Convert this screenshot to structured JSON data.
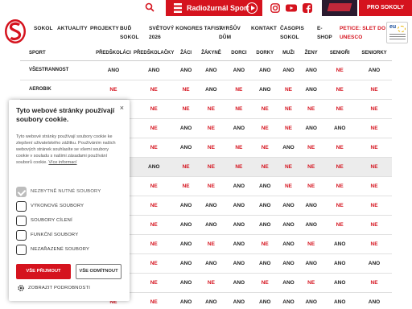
{
  "topbar": {
    "radio_label": "Radiožurnál Sport",
    "pro_sokoly": "PRO SOKOLY"
  },
  "nav": {
    "items": [
      {
        "l1": "SOKOL",
        "l2": ""
      },
      {
        "l1": "AKTUALITY",
        "l2": ""
      },
      {
        "l1": "PROJEKTY",
        "l2": ""
      },
      {
        "l1": "BUĎ",
        "l2": "SOKOL"
      },
      {
        "l1": "SVĚTOVÝ KONGRES TAFISA",
        "l2": "2026"
      },
      {
        "l1": "TYRŠŮV",
        "l2": "DŮM"
      },
      {
        "l1": "KONTAKT",
        "l2": ""
      },
      {
        "l1": "ČASOPIS",
        "l2": "SOKOL"
      },
      {
        "l1": "E-",
        "l2": "SHOP"
      },
      {
        "l1": "PETICE: SLET DO",
        "l2": "UNESCO"
      }
    ],
    "unesco_badge": "eu"
  },
  "table": {
    "headers": [
      "SPORT",
      "PŘEDŠKOLÁCI",
      "PŘEDŠKOLAČKY",
      "ŽÁCI",
      "ŽÁKYNĚ",
      "DORCI",
      "DORKY",
      "MUŽI",
      "ŽENY",
      "SENIOŘI",
      "SENIORKY"
    ],
    "rows": [
      {
        "sport": "VŠESTRANNOST",
        "cells": [
          "ANO",
          "ANO",
          "ANO",
          "ANO",
          "ANO",
          "ANO",
          "ANO",
          "ANO",
          "NE",
          "ANO"
        ]
      },
      {
        "sport": "AEROBIK",
        "cells": [
          "NE",
          "NE",
          "NE",
          "ANO",
          "NE",
          "ANO",
          "NE",
          "ANO",
          "NE",
          "NE"
        ]
      },
      {
        "sport": "",
        "cells": [
          "NE",
          "NE",
          "NE",
          "NE",
          "NE",
          "NE",
          "NE",
          "NE",
          "NE",
          "NE"
        ]
      },
      {
        "sport": "",
        "cells": [
          "NE",
          "NE",
          "ANO",
          "NE",
          "ANO",
          "NE",
          "NE",
          "ANO",
          "ANO",
          "NE"
        ]
      },
      {
        "sport": "",
        "cells": [
          "NE",
          "NE",
          "ANO",
          "NE",
          "NE",
          "NE",
          "ANO",
          "NE",
          "NE",
          "NE"
        ]
      },
      {
        "sport": "",
        "cells": [
          "ANO",
          "ANO",
          "NE",
          "NE",
          "NE",
          "NE",
          "NE",
          "NE",
          "NE",
          "NE"
        ],
        "highlight": true
      },
      {
        "sport": "",
        "cells": [
          "NE",
          "NE",
          "NE",
          "NE",
          "ANO",
          "ANO",
          "NE",
          "NE",
          "NE",
          "NE"
        ]
      },
      {
        "sport": "",
        "cells": [
          "NE",
          "NE",
          "ANO",
          "ANO",
          "ANO",
          "ANO",
          "ANO",
          "ANO",
          "NE",
          "NE"
        ]
      },
      {
        "sport": "",
        "cells": [
          "NE",
          "NE",
          "ANO",
          "ANO",
          "ANO",
          "ANO",
          "ANO",
          "ANO",
          "NE",
          "NE"
        ]
      },
      {
        "sport": "",
        "cells": [
          "NE",
          "NE",
          "ANO",
          "NE",
          "ANO",
          "NE",
          "ANO",
          "NE",
          "ANO",
          "NE"
        ]
      },
      {
        "sport": "",
        "cells": [
          "NE",
          "NE",
          "ANO",
          "ANO",
          "ANO",
          "ANO",
          "ANO",
          "ANO",
          "ANO",
          "ANO"
        ]
      },
      {
        "sport": "",
        "cells": [
          "NE",
          "NE",
          "ANO",
          "NE",
          "ANO",
          "NE",
          "ANO",
          "NE",
          "ANO",
          "NE"
        ]
      },
      {
        "sport": "",
        "cells": [
          "NE",
          "NE",
          "ANO",
          "ANO",
          "ANO",
          "ANO",
          "ANO",
          "ANO",
          "ANO",
          "ANO"
        ]
      }
    ]
  },
  "cookie": {
    "title": "Tyto webové stránky používají soubory cookie.",
    "description": "Tyto webové stránky používají soubory cookie ke zlepšení uživatelského zážitku. Používáním našich webových stránek souhlasíte se všemi soubory cookie v souladu s našimi zásadami používání souborů cookie.",
    "more_link": "Více informací",
    "options": [
      {
        "label": "NEZBYTNĚ NUTNÉ SOUBORY",
        "checked": true,
        "disabled": true
      },
      {
        "label": "VÝKONOVÉ SOUBORY",
        "checked": false
      },
      {
        "label": "SOUBORY CÍLENÍ",
        "checked": false
      },
      {
        "label": "FUNKČNÍ SOUBORY",
        "checked": false
      },
      {
        "label": "NEZAŘAZENÉ SOUBORY",
        "checked": false
      }
    ],
    "accept_label": "VŠE PŘIJMOUT",
    "reject_label": "VŠE ODMÍTNOUT",
    "details_label": "ZOBRAZIT PODROBNOSTI",
    "close_glyph": "×"
  },
  "colors": {
    "brand_red": "#d5131e",
    "text_dark": "#222222"
  }
}
